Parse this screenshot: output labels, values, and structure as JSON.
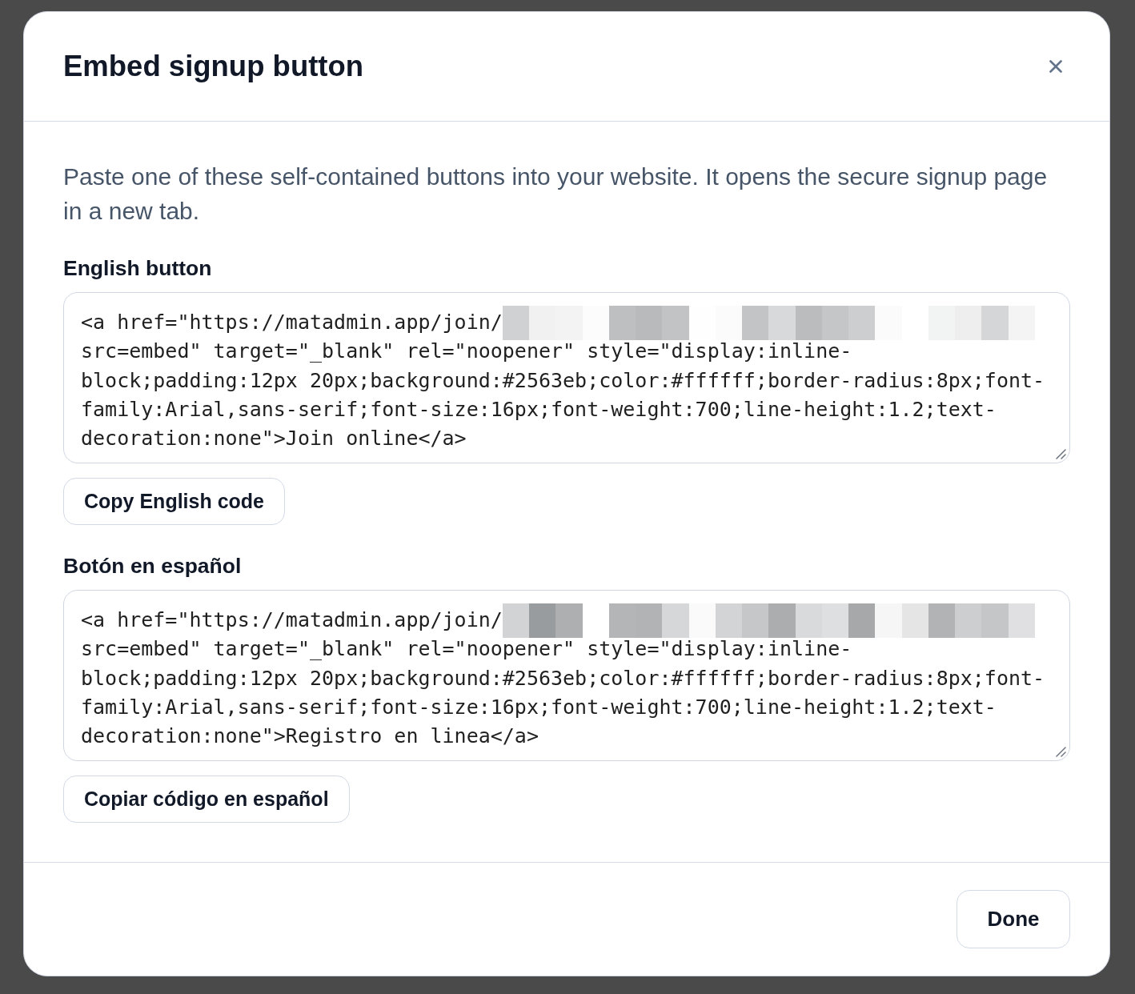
{
  "dialog": {
    "title": "Embed signup button",
    "description": "Paste one of these self-contained buttons into your website. It opens the secure signup page in a new tab.",
    "snippets": [
      {
        "label": "English button",
        "code_before_redaction": "<a href=\"https://matadmin.app/join/",
        "code_after_redaction": "src=embed\" target=\"_blank\" rel=\"noopener\" style=\"display:inline-block;padding:12px 20px;background:#2563eb;color:#ffffff;border-radius:8px;font-family:Arial,sans-serif;font-size:16px;font-weight:700;line-height:1.2;text-decoration:none\">Join online</a>",
        "copy_button": "Copy English code"
      },
      {
        "label": "Botón en español",
        "code_before_redaction": "<a href=\"https://matadmin.app/join/",
        "code_after_redaction": "src=embed\" target=\"_blank\" rel=\"noopener\" style=\"display:inline-block;padding:12px 20px;background:#2563eb;color:#ffffff;border-radius:8px;font-family:Arial,sans-serif;font-size:16px;font-weight:700;line-height:1.2;text-decoration:none\">Registro en linea</a>",
        "copy_button": "Copiar código en español"
      }
    ],
    "done_button": "Done"
  }
}
